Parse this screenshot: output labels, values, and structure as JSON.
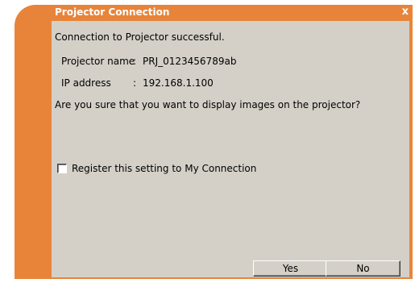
{
  "dialog": {
    "title": "Projector Connection",
    "close_glyph": "x",
    "message": "Connection to Projector successful.",
    "projector_name_label": "Projector name",
    "projector_name_sep": ":",
    "projector_name_value": "PRJ_0123456789ab",
    "ip_label": "IP address",
    "ip_sep": ":",
    "ip_value": "192.168.1.100",
    "question": "Are you sure that you want to display images on the projector?",
    "checkbox_label": "Register this setting to My Connection",
    "checkbox_checked": false,
    "yes_label": "Yes",
    "no_label": "No"
  },
  "colors": {
    "accent": "#e8843a",
    "panel": "#d4d0c8"
  }
}
